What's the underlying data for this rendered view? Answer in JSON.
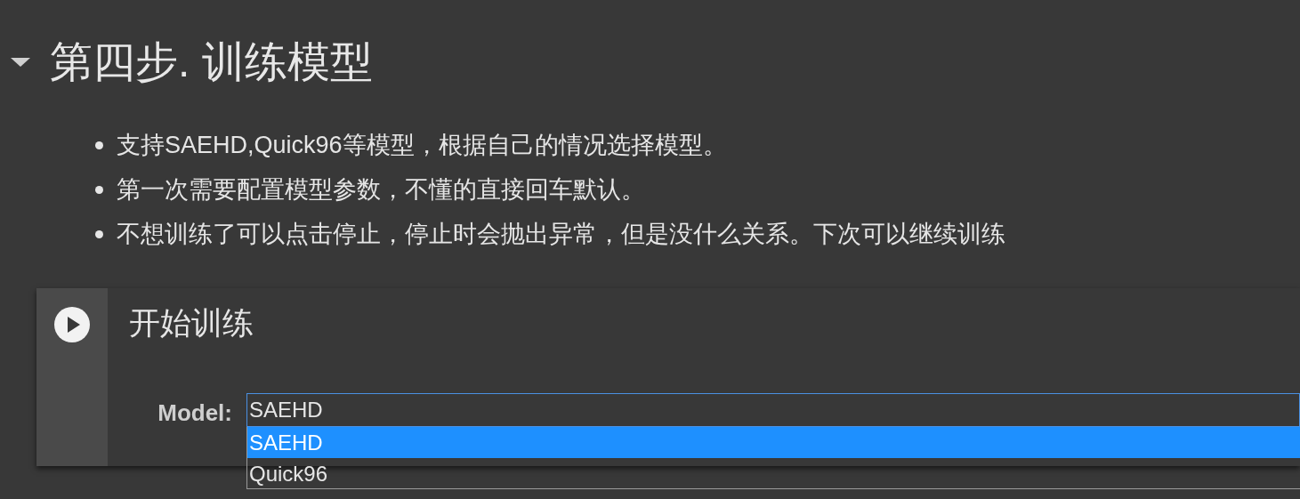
{
  "section": {
    "expanded": true,
    "title": "第四步. 训练模型"
  },
  "bullets": [
    "支持SAEHD,Quick96等模型，根据自己的情况选择模型。",
    "第一次需要配置模型参数，不懂的直接回车默认。",
    "不想训练了可以点击停止，停止时会抛出异常，但是没什么关系。下次可以继续训练"
  ],
  "cell": {
    "title": "开始训练",
    "field": {
      "label": "Model:",
      "value": "SAEHD",
      "expanded": true,
      "options": [
        {
          "label": "SAEHD",
          "selected": true
        },
        {
          "label": "Quick96",
          "selected": false
        }
      ]
    }
  }
}
